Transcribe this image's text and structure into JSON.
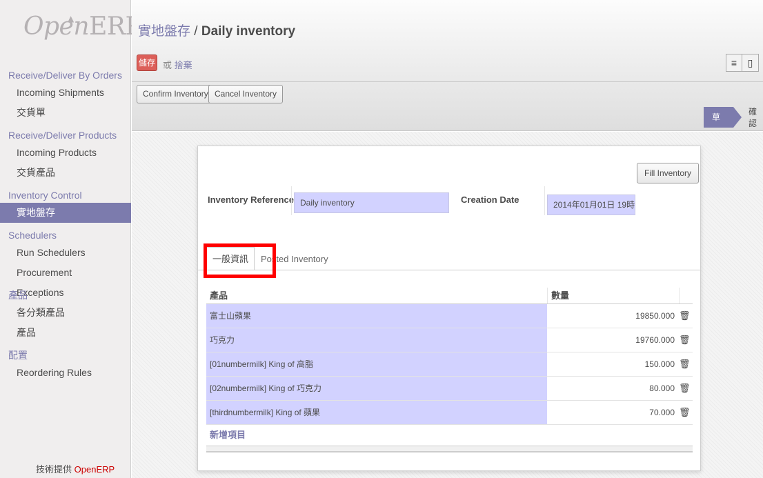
{
  "logo": {
    "text_italic": "Open",
    "text_rest": "ERP"
  },
  "sidebar": {
    "sections": [
      {
        "head": "Receive/Deliver By Orders",
        "items": [
          "Incoming Shipments",
          "交貨單"
        ]
      },
      {
        "head": "Receive/Deliver Products",
        "items": [
          "Incoming Products",
          "交貨產品"
        ]
      },
      {
        "head": "Inventory Control",
        "items": [
          "實地盤存"
        ]
      },
      {
        "head": "Schedulers",
        "items": [
          "Run Schedulers",
          "Procurement Exceptions"
        ]
      },
      {
        "head": "產品",
        "items": [
          "各分類產品",
          "產品"
        ]
      },
      {
        "head": "配置",
        "items": [
          "Reordering Rules"
        ]
      }
    ],
    "active_item": "實地盤存",
    "powered_by_label": "技術提供",
    "powered_by_brand": "OpenERP"
  },
  "header": {
    "breadcrumb_parent": "實地盤存",
    "breadcrumb_sep": " / ",
    "breadcrumb_current": "Daily inventory",
    "save_label": "儲存",
    "or_label": "或",
    "discard_label": "捨棄",
    "confirm_inventory": "Confirm Inventory",
    "cancel_inventory": "Cancel Inventory",
    "states": [
      "草案",
      "確認"
    ],
    "active_state": "草案"
  },
  "form": {
    "fill_inventory": "Fill Inventory",
    "inventory_reference_label": "Inventory Reference",
    "inventory_reference_value": "Daily inventory",
    "creation_date_label": "Creation Date",
    "creation_date_value": "2014年01月01日 19時",
    "tabs": [
      "一般資訊",
      "Posted Inventory"
    ],
    "active_tab": "一般資訊",
    "table": {
      "headers": [
        "產品",
        "數量"
      ],
      "rows": [
        {
          "product": "富士山蘋果",
          "qty": "19850.000"
        },
        {
          "product": "巧克力",
          "qty": "19760.000"
        },
        {
          "product": "[01numbermilk] King of 高脂",
          "qty": "150.000"
        },
        {
          "product": "[02numbermilk] King of 巧克力",
          "qty": "80.000"
        },
        {
          "product": "[thirdnumbermilk] King of 蘋果",
          "qty": "70.000"
        }
      ],
      "add_item": "新增項目"
    }
  },
  "colors": {
    "accent": "#7c7bad",
    "save": "#dc5f59",
    "highlight": "#ff0000",
    "field_bg": "#d2d2ff"
  }
}
